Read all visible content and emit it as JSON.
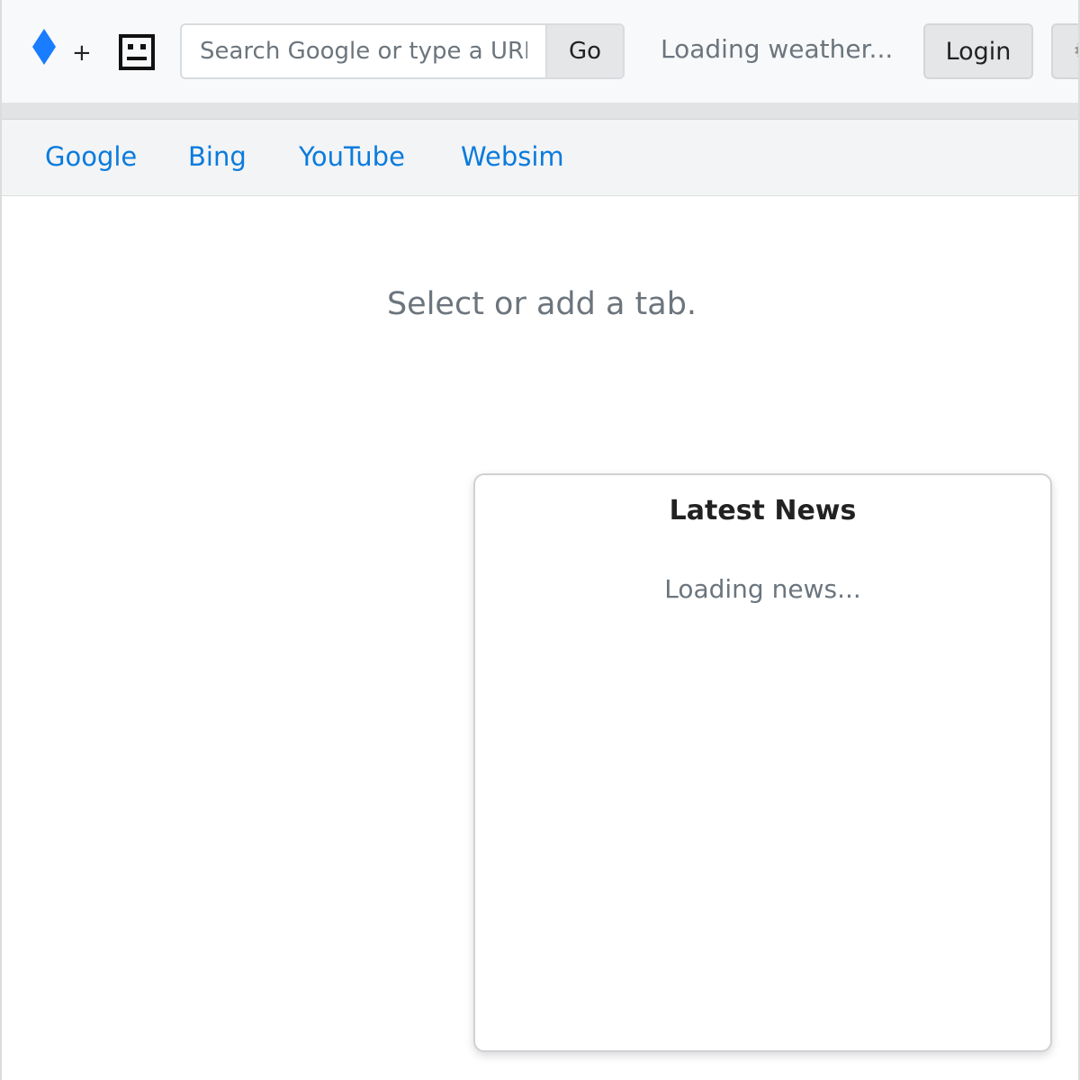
{
  "toolbar": {
    "logo_icon": "blue-diamond-icon",
    "new_tab_label": "+",
    "bot_icon": "robot-face-icon",
    "search": {
      "placeholder": "Search Google or type a URL",
      "value": "",
      "go_label": "Go"
    },
    "weather_text": "Loading weather...",
    "login_label": "Login",
    "settings_icon": "gear-icon",
    "accent_color": "#1a7cff"
  },
  "bookmarks": [
    {
      "label": "Google"
    },
    {
      "label": "Bing"
    },
    {
      "label": "YouTube"
    },
    {
      "label": "Websim"
    }
  ],
  "main": {
    "empty_message": "Select or add a tab."
  },
  "news": {
    "title": "Latest News",
    "status": "Loading news..."
  }
}
